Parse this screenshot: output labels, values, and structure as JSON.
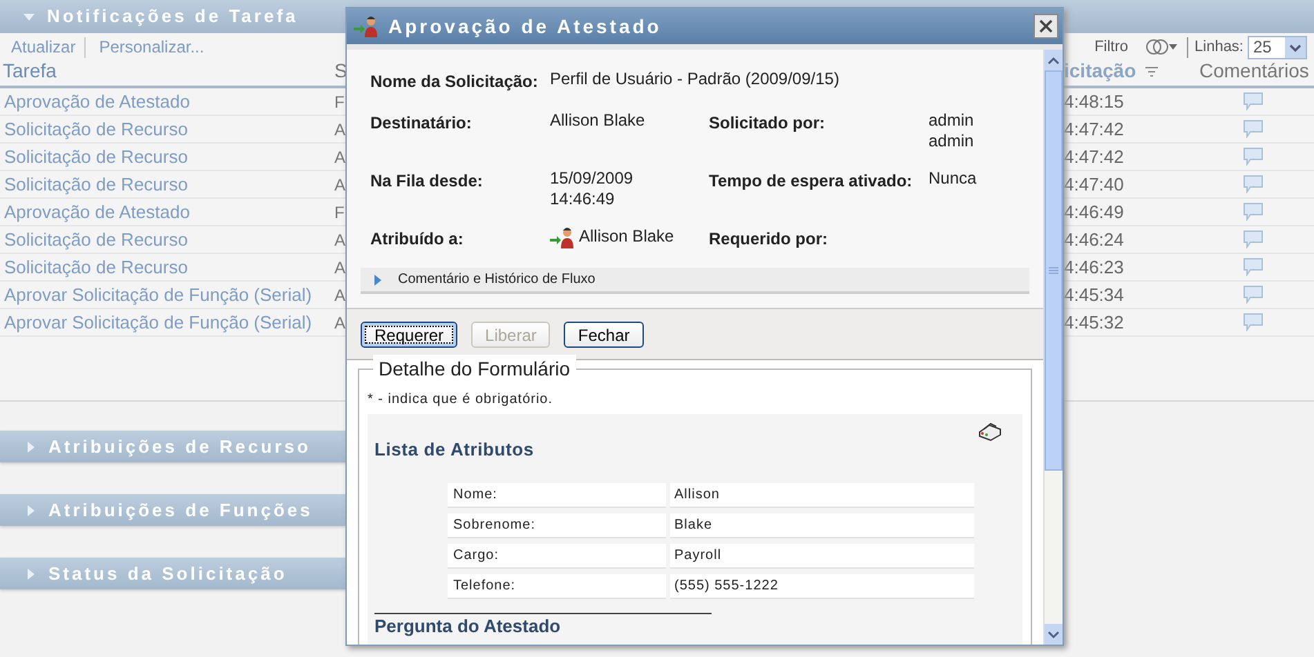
{
  "task_panel": {
    "title": "Notificações de Tarefa",
    "expanded": true,
    "toolbar": {
      "refresh": "Atualizar",
      "customize": "Personalizar...",
      "filter": "Filtro",
      "rows_label": "Linhas:",
      "rows_value": "25"
    },
    "columns": [
      {
        "label": "Tarefa",
        "sorted": false
      },
      {
        "label": "S",
        "sorted": false
      },
      {
        "label": "icitação",
        "sorted": true
      },
      {
        "label": "Comentários",
        "sorted": false
      }
    ],
    "rows": [
      {
        "task": "Aprovação de Atestado",
        "column_2": "F",
        "time": "4:48:15"
      },
      {
        "task": "Solicitação de Recurso",
        "column_2": "A",
        "time": "4:47:42"
      },
      {
        "task": "Solicitação de Recurso",
        "column_2": "A",
        "time": "4:47:42"
      },
      {
        "task": "Solicitação de Recurso",
        "column_2": "A",
        "time": "4:47:40"
      },
      {
        "task": "Aprovação de Atestado",
        "column_2": "F",
        "time": "4:46:49"
      },
      {
        "task": "Solicitação de Recurso",
        "column_2": "A",
        "time": "4:46:24"
      },
      {
        "task": "Solicitação de Recurso",
        "column_2": "A",
        "time": "4:46:23"
      },
      {
        "task": "Aprovar Solicitação de Função (Serial)",
        "column_2": "A",
        "time": "4:45:34"
      },
      {
        "task": "Aprovar Solicitação de Função (Serial)",
        "column_2": "A",
        "time": "4:45:32"
      }
    ]
  },
  "sections": [
    {
      "title": "Atribuições de Recurso",
      "expanded": false
    },
    {
      "title": "Atribuições de Funções",
      "expanded": false
    },
    {
      "title": "Status da Solicitação",
      "expanded": false
    }
  ],
  "dialog": {
    "title": "Aprovação de Atestado",
    "details": [
      [
        {
          "label": "Nome da Solicitação:",
          "kind": "text",
          "lines": [
            "Perfil de Usuário - Padrão (2009/09/15)"
          ]
        }
      ],
      [
        {
          "label": "Destinatário:",
          "kind": "text",
          "lines": [
            "Allison Blake"
          ]
        },
        {
          "label": "Solicitado por:",
          "kind": "text",
          "lines": [
            "admin",
            "admin"
          ]
        }
      ],
      [
        {
          "label": "Na Fila desde:",
          "kind": "text",
          "lines": [
            "15/09/2009",
            "14:46:49"
          ]
        },
        {
          "label": "Tempo de espera ativado:",
          "kind": "text",
          "lines": [
            "Nunca"
          ]
        }
      ],
      [
        {
          "label": "Atribuído a:",
          "kind": "user",
          "lines": [
            "Allison Blake"
          ]
        },
        {
          "label": "Requerido por:",
          "kind": "text"
        }
      ]
    ],
    "history": {
      "label": "Comentário e Histórico de Fluxo",
      "expanded": false
    },
    "buttons": [
      {
        "label": "Requerer",
        "disabled": false,
        "focused": true
      },
      {
        "label": "Liberar",
        "disabled": true,
        "focused": false
      },
      {
        "label": "Fechar",
        "disabled": false,
        "focused": false
      }
    ],
    "form": {
      "legend": "Detalhe do Formulário",
      "note": "* - indica que é obrigatório.",
      "section_title": "Lista de Atributos",
      "attributes": [
        {
          "label": "Nome:",
          "value": "Allison"
        },
        {
          "label": "Sobrenome:",
          "value": "Blake"
        },
        {
          "label": "Cargo:",
          "value": "Payroll"
        },
        {
          "label": "Telefone:",
          "value": "(555) 555-1222"
        }
      ],
      "next_heading": "Pergunta do Atestado"
    }
  }
}
